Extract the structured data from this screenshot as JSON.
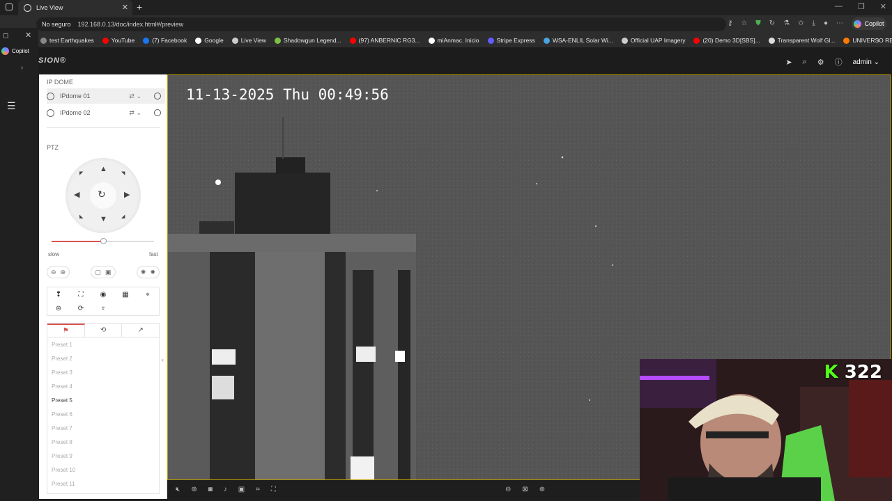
{
  "browser": {
    "tab_title": "Live View",
    "url_warning": "No seguro",
    "url": "192.168.0.13/doc/index.html#/preview",
    "copilot_label": "Copilot",
    "bookmarks": [
      {
        "label": "test Earthquakes",
        "color": "#888888"
      },
      {
        "label": "YouTube",
        "color": "#ff0000"
      },
      {
        "label": "(7) Facebook",
        "color": "#1877f2"
      },
      {
        "label": "Google",
        "color": "#ffffff"
      },
      {
        "label": "Live View",
        "color": "#cccccc"
      },
      {
        "label": "Shadowgun Legend...",
        "color": "#7cc242"
      },
      {
        "label": "(97) ANBERNIC RG3...",
        "color": "#ff0000"
      },
      {
        "label": "miAnmac. Inicio",
        "color": "#ffffff"
      },
      {
        "label": "Stripe Express",
        "color": "#635bff"
      },
      {
        "label": "WSA-ENLIL Solar Wi...",
        "color": "#4aa3df"
      },
      {
        "label": "Official UAP Imagery",
        "color": "#cccccc"
      },
      {
        "label": "(20) Demo 3D[SBS]...",
        "color": "#ff0000"
      },
      {
        "label": "Transparent Wolf Gl...",
        "color": "#dddddd"
      },
      {
        "label": "UNIVERSO RETRO...",
        "color": "#ff7a00"
      }
    ]
  },
  "sidebar_rail": {
    "copilot_label": "Copilot"
  },
  "app": {
    "brand": "SION®",
    "admin_label": "admin"
  },
  "panel": {
    "camera_section": "IP DOME",
    "cameras": [
      "IPdome 01",
      "IPdome 02"
    ],
    "ptz_title": "PTZ",
    "speed_slow": "slow",
    "speed_fast": "fast",
    "speed_level": 0.5,
    "presets": [
      "Preset 1",
      "Preset 2",
      "Preset 3",
      "Preset 4",
      "Preset 5",
      "Preset 6",
      "Preset 7",
      "Preset 8",
      "Preset 9",
      "Preset 10",
      "Preset 11"
    ],
    "active_preset_index": 4
  },
  "video": {
    "osd_timestamp": "11-13-2025 Thu 00:49:56"
  },
  "overlay": {
    "kick_icon": "K",
    "viewer_count": "322"
  },
  "colors": {
    "accent": "#d9534f",
    "video_border": "#b89a00",
    "kick_green": "#53fc18"
  }
}
